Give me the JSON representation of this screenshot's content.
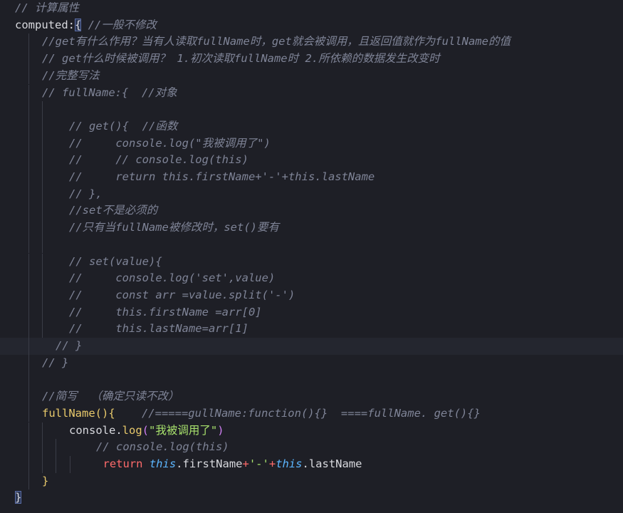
{
  "editor": {
    "theme": {
      "background": "#1e1f26",
      "comment": "#7f8497",
      "function": "#e8c96b",
      "string": "#a7e06c",
      "keyword": "#ff6b6b",
      "this": "#5cb6ff",
      "paren": "#cf7ff2"
    },
    "lines": [
      {
        "indent": 1,
        "guides": 0,
        "segments": [
          {
            "t": "// 计算属性",
            "c": "comment"
          }
        ]
      },
      {
        "indent": 1,
        "guides": 0,
        "segments": [
          {
            "t": "computed:",
            "c": "prop"
          },
          {
            "t": "{",
            "c": "brace-match"
          },
          {
            "t": " //一般不修改",
            "c": "comment"
          }
        ]
      },
      {
        "indent": 3,
        "guides": 1,
        "segments": [
          {
            "t": "//get有什么作用？当有人读取fullName时，get就会被调用，且返回值就作为fullName的值",
            "c": "comment"
          }
        ]
      },
      {
        "indent": 3,
        "guides": 1,
        "segments": [
          {
            "t": "// get什么时候被调用？ 1.初次读取fullName时 2.所依赖的数据发生改变时",
            "c": "comment"
          }
        ]
      },
      {
        "indent": 3,
        "guides": 1,
        "segments": [
          {
            "t": "//完整写法",
            "c": "comment"
          }
        ]
      },
      {
        "indent": 3,
        "guides": 1,
        "segments": [
          {
            "t": "// fullName:{  //对象",
            "c": "comment"
          }
        ]
      },
      {
        "indent": 3,
        "guides": 2,
        "segments": []
      },
      {
        "indent": 5,
        "guides": 2,
        "segments": [
          {
            "t": "// get(){  //函数",
            "c": "comment"
          }
        ]
      },
      {
        "indent": 5,
        "guides": 2,
        "segments": [
          {
            "t": "//     console.log(\"我被调用了\")",
            "c": "comment"
          }
        ]
      },
      {
        "indent": 5,
        "guides": 2,
        "segments": [
          {
            "t": "//     // console.log(this)",
            "c": "comment"
          }
        ]
      },
      {
        "indent": 5,
        "guides": 2,
        "segments": [
          {
            "t": "//     return this.firstName+'-'+this.lastName",
            "c": "comment"
          }
        ]
      },
      {
        "indent": 5,
        "guides": 2,
        "segments": [
          {
            "t": "// },",
            "c": "comment"
          }
        ]
      },
      {
        "indent": 5,
        "guides": 2,
        "segments": [
          {
            "t": "//set不是必须的",
            "c": "comment"
          }
        ]
      },
      {
        "indent": 5,
        "guides": 2,
        "segments": [
          {
            "t": "//只有当fullName被修改时，set()要有",
            "c": "comment"
          }
        ]
      },
      {
        "indent": 3,
        "guides": 2,
        "segments": []
      },
      {
        "indent": 5,
        "guides": 2,
        "segments": [
          {
            "t": "// set(value){",
            "c": "comment"
          }
        ]
      },
      {
        "indent": 5,
        "guides": 2,
        "segments": [
          {
            "t": "//     console.log('set',value)",
            "c": "comment"
          }
        ]
      },
      {
        "indent": 5,
        "guides": 2,
        "segments": [
          {
            "t": "//     const arr =value.split('-')",
            "c": "comment"
          }
        ]
      },
      {
        "indent": 5,
        "guides": 2,
        "segments": [
          {
            "t": "//     this.firstName =arr[0]",
            "c": "comment"
          }
        ]
      },
      {
        "indent": 5,
        "guides": 2,
        "segments": [
          {
            "t": "//     this.lastName=arr[1]",
            "c": "comment"
          }
        ]
      },
      {
        "indent": 4,
        "guides": 1,
        "current": true,
        "segments": [
          {
            "t": "// }",
            "c": "comment"
          }
        ]
      },
      {
        "indent": 3,
        "guides": 1,
        "segments": [
          {
            "t": "// }",
            "c": "comment"
          }
        ]
      },
      {
        "indent": 3,
        "guides": 1,
        "segments": []
      },
      {
        "indent": 3,
        "guides": 1,
        "segments": [
          {
            "t": "//简写  （确定只读不改）",
            "c": "comment"
          }
        ]
      },
      {
        "indent": 3,
        "guides": 1,
        "segments": [
          {
            "t": "fullName",
            "c": "fn"
          },
          {
            "t": "(){",
            "c": "fn"
          },
          {
            "t": "    //=====gullName:function(){}  ====fullName. get(){}",
            "c": "comment"
          }
        ]
      },
      {
        "indent": 5,
        "guides": 2,
        "segments": [
          {
            "t": "console",
            "c": "member"
          },
          {
            "t": ".",
            "c": "punct"
          },
          {
            "t": "log",
            "c": "fn"
          },
          {
            "t": "(",
            "c": "paren"
          },
          {
            "t": "\"我被调用了\"",
            "c": "str"
          },
          {
            "t": ")",
            "c": "paren"
          }
        ]
      },
      {
        "indent": 7,
        "guides": 3,
        "segments": [
          {
            "t": "// console.log(this)",
            "c": "comment"
          }
        ]
      },
      {
        "indent": 7.5,
        "guides": 4,
        "segments": [
          {
            "t": "return",
            "c": "kw"
          },
          {
            "t": " ",
            "c": "punct"
          },
          {
            "t": "this",
            "c": "this"
          },
          {
            "t": ".firstName",
            "c": "member"
          },
          {
            "t": "+",
            "c": "op"
          },
          {
            "t": "'-'",
            "c": "str"
          },
          {
            "t": "+",
            "c": "op"
          },
          {
            "t": "this",
            "c": "this"
          },
          {
            "t": ".lastName",
            "c": "member"
          }
        ]
      },
      {
        "indent": 3,
        "guides": 1,
        "segments": [
          {
            "t": "}",
            "c": "fn"
          }
        ]
      },
      {
        "indent": 1,
        "guides": 0,
        "segments": [
          {
            "t": "}",
            "c": "brace-match"
          }
        ]
      }
    ]
  }
}
